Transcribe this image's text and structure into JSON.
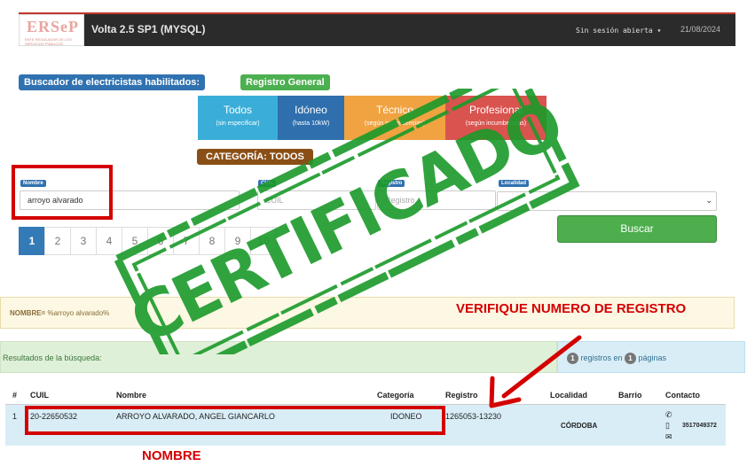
{
  "nav": {
    "logo": "ERSeP",
    "logo_sub": "ENTE REGULADOR DE LOS SERVICIOS PÚBLICOS",
    "app_title": "Volta 2.5 SP1 (MYSQL)",
    "session": "Sin sesión abierta ▾",
    "date": "21/08/2024"
  },
  "header": {
    "buscador_label": "Buscador de electricistas habilitados:",
    "registro_label": "Registro General",
    "categoria_label": "CATEGORÍA: TODOS"
  },
  "tabs": [
    {
      "title": "Todos",
      "sub": "(sin especificar)"
    },
    {
      "title": "Idóneo",
      "sub": "(hasta 10kW)"
    },
    {
      "title": "Técnico",
      "sub": "(según incumbencias)"
    },
    {
      "title": "Profesional",
      "sub": "(según incumbencias)"
    }
  ],
  "form": {
    "nombre_label": "Nombre",
    "nombre_value": "arroyo alvarado",
    "cuil_label": "CUIL",
    "cuil_placeholder": "CUIL",
    "registro_label": "Registro",
    "registro_placeholder": "Registro",
    "localidad_label": "Localidad",
    "buscar": "Buscar"
  },
  "pagination": [
    "1",
    "2",
    "3",
    "4",
    "5",
    "6",
    "7",
    "8",
    "9",
    "10"
  ],
  "filter": {
    "key": "NOMBRE=",
    "value": " %arroyo alvarado%"
  },
  "results": {
    "label": "Resultados de la búsqueda:",
    "count": "1",
    "text_mid": " registros en ",
    "pages": "1",
    "text_end": " páginas"
  },
  "table": {
    "headers": [
      "#",
      "CUIL",
      "Nombre",
      "Categoría",
      "Registro",
      "Localidad",
      "Barrio",
      "Contacto"
    ],
    "row": {
      "num": "1",
      "cuil": "20-22650532",
      "nombre": "ARROYO ALVARADO, ANGEL GIANCARLO",
      "categoria": "IDONEO",
      "registro": "1265053-13230",
      "localidad": "CÓRDOBA",
      "contacto": "3517049372"
    }
  },
  "annotations": {
    "verifique": "VERIFIQUE NUMERO DE REGISTRO",
    "nombre": "NOMBRE",
    "stamp": "CERTIFICADO"
  },
  "colors": {
    "stamp_green": "#1a9a2a",
    "annotation_red": "#d40000",
    "primary_blue": "#337ab7"
  }
}
